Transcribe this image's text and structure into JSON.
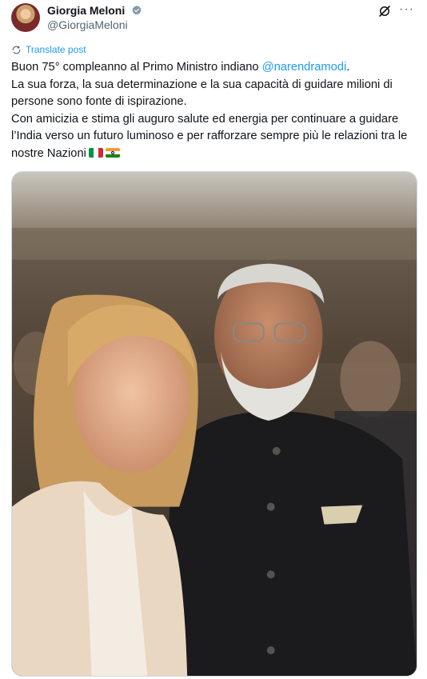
{
  "author": {
    "display_name": "Giorgia Meloni",
    "handle": "@GiorgiaMeloni",
    "verified_icon": "verified-badge-icon",
    "avatar_icon": "avatar"
  },
  "actions": {
    "grok_icon": "grok-icon",
    "more_label": "···"
  },
  "translate_label": "Translate post",
  "tweet": {
    "line1_prefix": "Buon 75° compleanno al Primo Ministro indiano ",
    "mention": "@narendramodi",
    "line1_suffix": ".",
    "line2": "La sua forza, la sua determinazione e la sua capacità di guidare milioni di persone sono fonte di ispirazione.",
    "line3": "Con amicizia e stima gli auguro salute ed energia per continuare a guidare l’India verso un futuro luminoso e per rafforzare sempre più le relazioni tra le nostre Nazioni",
    "flags": [
      "flag-italy-icon",
      "flag-india-icon"
    ]
  },
  "colors": {
    "accent": "#1d9bf0",
    "text": "#0f1419",
    "secondary": "#536471"
  }
}
